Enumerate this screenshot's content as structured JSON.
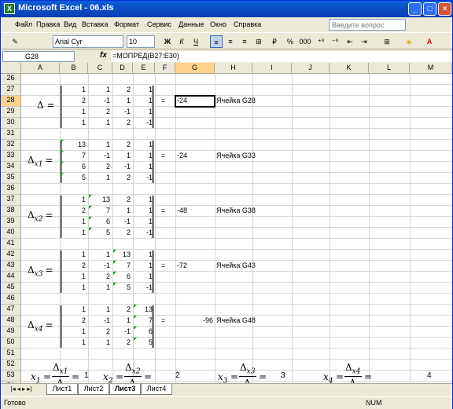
{
  "window": {
    "title": "Microsoft Excel - 06.xls",
    "app_icon_letter": "X",
    "minimize": "_",
    "restore": "□",
    "close": "×"
  },
  "menu": [
    "Файл",
    "Правка",
    "Вид",
    "Вставка",
    "Формат",
    "Сервис",
    "Данные",
    "Окно",
    "Справка"
  ],
  "help_placeholder": "Введите вопрос",
  "toolbar": {
    "font": "Arial Cyr",
    "size": "10",
    "bold": "Ж",
    "italic": "К",
    "underline": "Ч",
    "percent": "%",
    "thousands": "000"
  },
  "formula_bar": {
    "cell": "G28",
    "fx": "fx",
    "formula": "=МОПРЕД(B27:E30)"
  },
  "columns": [
    "A",
    "B",
    "C",
    "D",
    "E",
    "F",
    "G",
    "H",
    "I",
    "J",
    "K",
    "L",
    "M"
  ],
  "rows": [
    "26",
    "27",
    "28",
    "29",
    "30",
    "31",
    "32",
    "33",
    "34",
    "35",
    "36",
    "37",
    "38",
    "39",
    "40",
    "41",
    "42",
    "43",
    "44",
    "45",
    "46",
    "47",
    "48",
    "49",
    "50",
    "51",
    "52",
    "53",
    "54"
  ],
  "matrices": [
    {
      "rows": [
        [
          "1",
          "1",
          "2",
          "1"
        ],
        [
          "2",
          "-1",
          "1",
          "1"
        ],
        [
          "1",
          "2",
          "-1",
          "1"
        ],
        [
          "1",
          "1",
          "2",
          "-1"
        ]
      ],
      "result": "-24",
      "label": "Ячейка G28",
      "delta": "Δ =",
      "sub": ""
    },
    {
      "rows": [
        [
          "13",
          "1",
          "2",
          "1"
        ],
        [
          "7",
          "-1",
          "1",
          "1"
        ],
        [
          "6",
          "2",
          "-1",
          "1"
        ],
        [
          "5",
          "1",
          "2",
          "-1"
        ]
      ],
      "result": "-24",
      "label": "Ячейка G33",
      "delta": "Δ",
      "sub": "x1"
    },
    {
      "rows": [
        [
          "1",
          "13",
          "2",
          "1"
        ],
        [
          "2",
          "7",
          "1",
          "1"
        ],
        [
          "1",
          "6",
          "-1",
          "1"
        ],
        [
          "1",
          "5",
          "2",
          "-1"
        ]
      ],
      "result": "-48",
      "label": "Ячейка G38",
      "delta": "Δ",
      "sub": "x2"
    },
    {
      "rows": [
        [
          "1",
          "1",
          "13",
          "1"
        ],
        [
          "2",
          "-1",
          "7",
          "1"
        ],
        [
          "1",
          "2",
          "6",
          "1"
        ],
        [
          "1",
          "1",
          "5",
          "-1"
        ]
      ],
      "result": "-72",
      "label": "Ячейка G43",
      "delta": "Δ",
      "sub": "x3"
    },
    {
      "rows": [
        [
          "1",
          "1",
          "2",
          "13"
        ],
        [
          "2",
          "-1",
          "1",
          "7"
        ],
        [
          "1",
          "2",
          "-1",
          "6"
        ],
        [
          "1",
          "1",
          "2",
          "5"
        ]
      ],
      "result": "-96",
      "label": "Ячейка G48",
      "delta": "Δ",
      "sub": "x4"
    }
  ],
  "eq_sign": "=",
  "solutions": [
    {
      "x": "x",
      "sub": "1",
      "num": "Δ",
      "nsub": "x1",
      "den": "Δ",
      "val": "1"
    },
    {
      "x": "x",
      "sub": "2",
      "num": "Δ",
      "nsub": "x2",
      "den": "Δ",
      "val": "2"
    },
    {
      "x": "x",
      "sub": "3",
      "num": "Δ",
      "nsub": "x3",
      "den": "Δ",
      "val": "3"
    },
    {
      "x": "x",
      "sub": "4",
      "num": "Δ",
      "nsub": "x4",
      "den": "Δ",
      "val": "4"
    }
  ],
  "sheets": [
    "Лист1",
    "Лист2",
    "Лист3",
    "Лист4"
  ],
  "active_sheet": "Лист3",
  "status": {
    "left": "Готово",
    "num": "NUM"
  }
}
